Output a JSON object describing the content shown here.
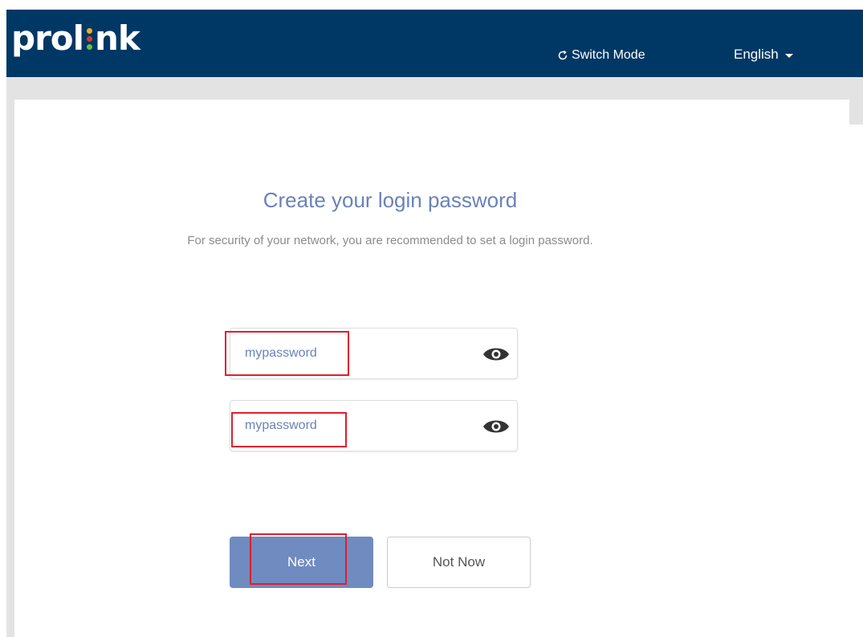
{
  "header": {
    "logo_left": "prol",
    "logo_right": "nk",
    "switch_mode_label": "Switch Mode",
    "language_label": "English",
    "colors": {
      "header_bg": "#003865",
      "logo_dot_top": "#e8b21e",
      "logo_dot_mid": "#e03a2f",
      "logo_dot_bottom": "#6cbe45"
    }
  },
  "main": {
    "title": "Create your login password",
    "subtitle": "For security of your network, you are recommended to set a login password.",
    "password_field": {
      "value": "mypassword",
      "icon": "eye-icon"
    },
    "confirm_password_field": {
      "value": "mypassword",
      "icon": "eye-icon"
    },
    "buttons": {
      "next_label": "Next",
      "not_now_label": "Not Now"
    }
  },
  "accent_colors": {
    "primary_button": "#6f8bc0",
    "title_text": "#6a82b8",
    "highlight_box": "#e01e2d"
  }
}
